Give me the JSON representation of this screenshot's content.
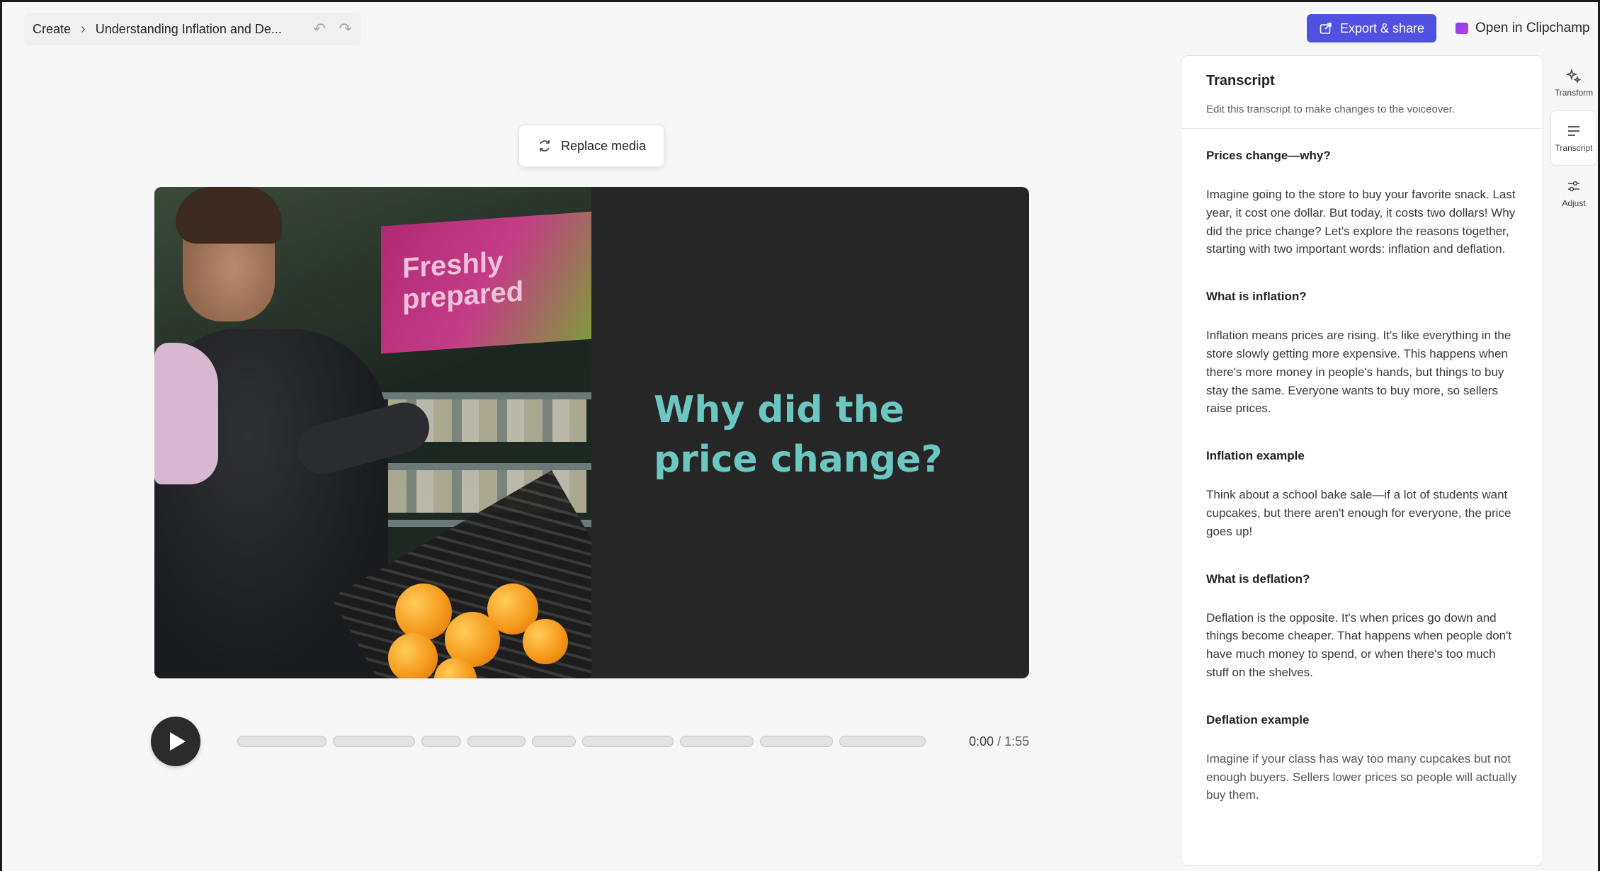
{
  "header": {
    "breadcrumb": [
      "Create",
      "Understanding Inflation and De..."
    ],
    "export_label": "Export & share",
    "open_label": "Open in Clipchamp"
  },
  "editor": {
    "replace_label": "Replace media",
    "video_title": "Why did the price change?",
    "time_current": "0:00",
    "time_total": "1:55"
  },
  "transcript": {
    "title": "Transcript",
    "subtitle": "Edit this transcript to make changes to the voiceover.",
    "sections": [
      {
        "title": "Prices change—why?",
        "text": "Imagine going to the store to buy your favorite snack. Last year, it cost one dollar. But today, it costs two dollars! Why did the price change? Let's explore the reasons together, starting with two important words: inflation and deflation."
      },
      {
        "title": "What is inflation?",
        "text": "Inflation means prices are rising. It's like everything in the store slowly getting more expensive. This happens when there's more money in people's hands, but things to buy stay the same. Everyone wants to buy more, so sellers raise prices."
      },
      {
        "title": "Inflation example",
        "text": "Think about a school bake sale—if a lot of students want cupcakes, but there aren't enough for everyone, the price goes up!"
      },
      {
        "title": "What is deflation?",
        "text": "Deflation is the opposite. It's when prices go down and things become cheaper. That happens when people don't have much money to spend, or when there's too much stuff on the shelves."
      },
      {
        "title": "Deflation example",
        "text": "Imagine if your class has way too many cupcakes but not enough buyers. Sellers lower prices so people will actually buy them."
      }
    ]
  },
  "rail": {
    "items": [
      "Transform",
      "Transcript",
      "Adjust"
    ]
  },
  "colors": {
    "accent": "#4f52e0",
    "title_teal": "#6cc7c0"
  }
}
